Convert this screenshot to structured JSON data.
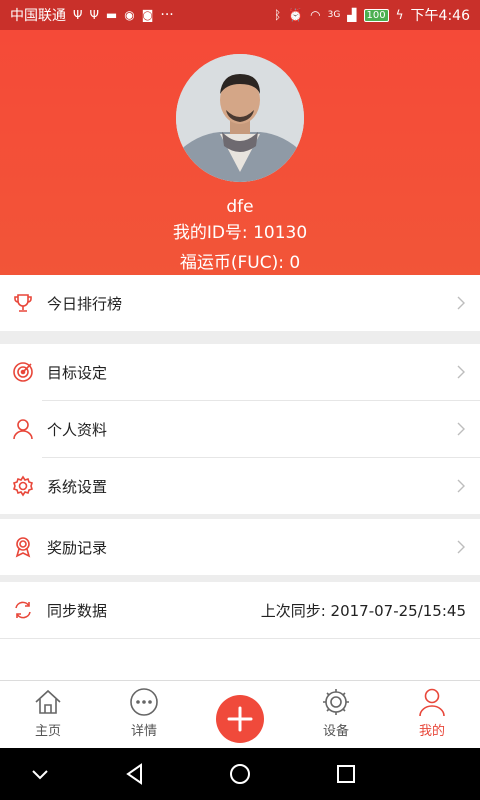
{
  "status_bar": {
    "carrier": "中国联通",
    "more": "···",
    "network": "3G",
    "battery": "100",
    "time": "下午4:46"
  },
  "profile": {
    "username": "dfe",
    "id_line": "我的ID号: 10130",
    "coins_line": "福运币(FUC): 0"
  },
  "menu": {
    "ranking": "今日排行榜",
    "goal": "目标设定",
    "personal": "个人资料",
    "settings": "系统设置",
    "rewards": "奖励记录",
    "sync": "同步数据",
    "sync_value": "上次同步: 2017-07-25/15:45"
  },
  "tabs": {
    "home": "主页",
    "details": "详情",
    "device": "设备",
    "mine": "我的"
  },
  "colors": {
    "accent": "#f04a3b",
    "header": "#f54a38",
    "statusbar": "#c9302a"
  },
  "icons": {
    "ranking": "trophy-icon",
    "goal": "target-icon",
    "personal": "person-icon",
    "settings": "gear-icon",
    "rewards": "medal-icon",
    "sync": "sync-icon",
    "home": "home-icon",
    "details": "more-dots-icon",
    "add": "plus-icon",
    "device": "device-gear-icon",
    "mine": "user-icon"
  }
}
